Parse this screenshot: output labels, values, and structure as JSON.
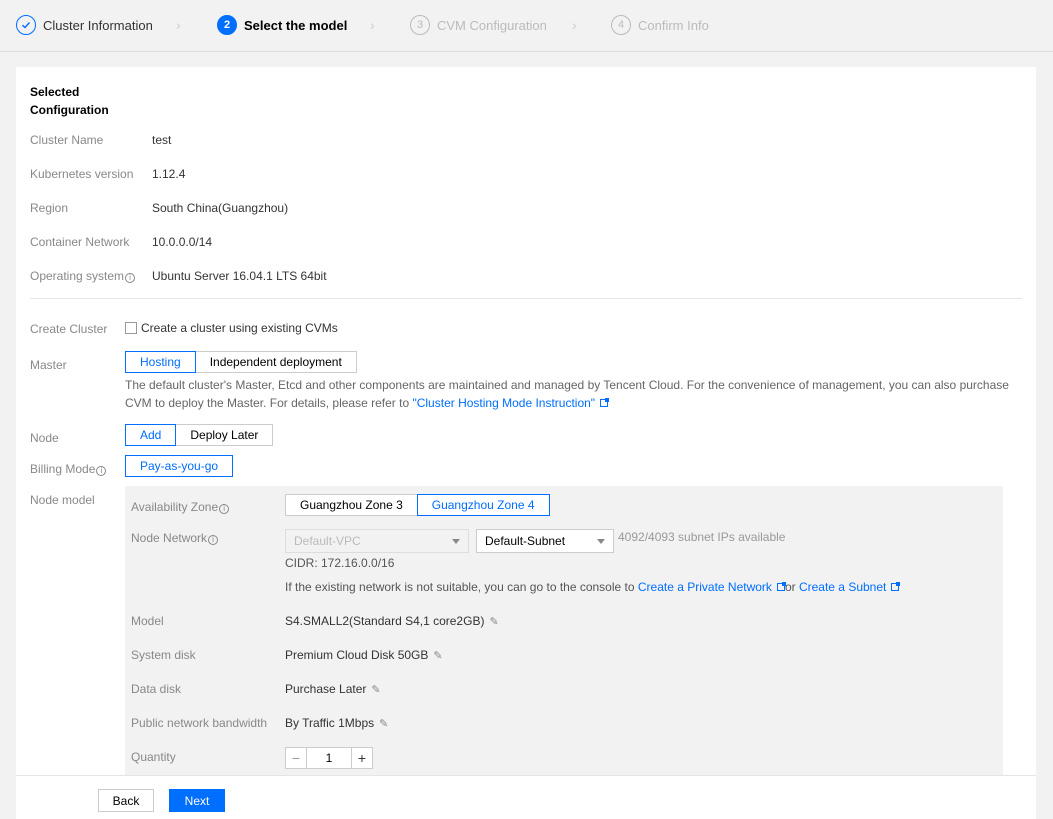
{
  "steps": [
    {
      "num": "",
      "label": "Cluster Information",
      "state": "done"
    },
    {
      "num": "2",
      "label": "Select the model",
      "state": "active"
    },
    {
      "num": "3",
      "label": "CVM Configuration",
      "state": "pending"
    },
    {
      "num": "4",
      "label": "Confirm Info",
      "state": "pending"
    }
  ],
  "summary": {
    "title": "Selected Configuration",
    "rows": [
      {
        "label": "Cluster Name",
        "value": "test"
      },
      {
        "label": "Kubernetes version",
        "value": "1.12.4"
      },
      {
        "label": "Region",
        "value": "South China(Guangzhou)"
      },
      {
        "label": "Container Network",
        "value": "10.0.0.0/14"
      },
      {
        "label": "Operating system",
        "value": "Ubuntu Server 16.04.1 LTS 64bit"
      }
    ]
  },
  "form": {
    "create_cluster_label": "Create Cluster",
    "create_cluster_checkbox": "Create a cluster using existing CVMs",
    "master_label": "Master",
    "master_options": [
      "Hosting",
      "Independent deployment"
    ],
    "master_desc": "The default cluster's Master, Etcd and other components are maintained and managed by Tencent Cloud. For the convenience of management, you can also purchase CVM to deploy the Master. For details, please refer to ",
    "master_link": "\"Cluster Hosting Mode Instruction\"",
    "node_label": "Node",
    "node_options": [
      "Add",
      "Deploy Later"
    ],
    "billing_label": "Billing Mode",
    "billing_options": [
      "Pay-as-you-go"
    ],
    "node_model_label": "Node model"
  },
  "node_model": {
    "az_label": "Availability Zone",
    "az_options": [
      "Guangzhou Zone 3",
      "Guangzhou Zone 4"
    ],
    "network_label": "Node Network",
    "vpc_select": "Default-VPC",
    "subnet_select": "Default-Subnet",
    "subnet_ips": "4092/4093 subnet IPs available",
    "cidr": "CIDR: 172.16.0.0/16",
    "network_hint": "If the existing network is not suitable, you can go to the console to ",
    "link_private_network": "Create a Private Network",
    "or_text": "or",
    "link_subnet": "Create a Subnet",
    "model_label": "Model",
    "model_value": "S4.SMALL2(Standard S4,1 core2GB)",
    "system_disk_label": "System disk",
    "system_disk_value": "Premium Cloud Disk 50GB",
    "data_disk_label": "Data disk",
    "data_disk_value": "Purchase Later",
    "bandwidth_label": "Public network bandwidth",
    "bandwidth_value": "By Traffic 1Mbps",
    "quantity_label": "Quantity",
    "quantity_value": "1"
  },
  "footer": {
    "back": "Back",
    "next": "Next"
  },
  "colors": {
    "accent": "#006eff"
  }
}
